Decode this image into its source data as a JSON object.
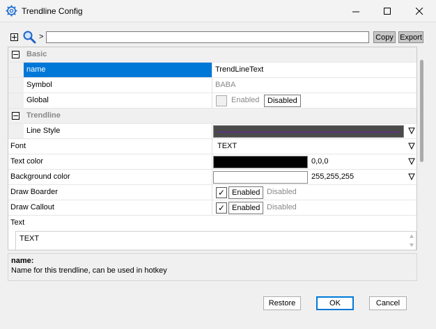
{
  "window": {
    "title": "Trendline Config"
  },
  "toolbar": {
    "search_prefix": ">",
    "search_value": "",
    "copy_label": "Copy",
    "export_label": "Export"
  },
  "grid": {
    "categories": {
      "basic": "Basic",
      "trendline": "Trendline"
    },
    "rows": {
      "name": {
        "label": "name",
        "value": "TrendLineText"
      },
      "symbol": {
        "label": "Symbol",
        "value": "BABA"
      },
      "global": {
        "label": "Global",
        "enabled": "Enabled",
        "disabled": "Disabled"
      },
      "line_style": {
        "label": "Line Style",
        "swatch_color": "#4a4a4a",
        "line_color": "#6a1fb0"
      },
      "font": {
        "label": "Font",
        "value": "TEXT"
      },
      "text_color": {
        "label": "Text color",
        "value": "0,0,0",
        "swatch_color": "#000000"
      },
      "background_color": {
        "label": "Background color",
        "value": "255,255,255",
        "swatch_color": "#ffffff"
      },
      "draw_boarder": {
        "label": "Draw Boarder",
        "enabled": "Enabled",
        "disabled": "Disabled",
        "checkmark": "✓"
      },
      "draw_callout": {
        "label": "Draw Callout",
        "enabled": "Enabled",
        "disabled": "Disabled",
        "checkmark": "✓"
      },
      "text": {
        "label": "Text",
        "value": "TEXT"
      }
    }
  },
  "description": {
    "title": "name:",
    "text": "Name for this trendline, can be used in hotkey"
  },
  "buttons": {
    "restore": "Restore",
    "ok": "OK",
    "cancel": "Cancel"
  },
  "colors": {
    "accent": "#0078d7"
  }
}
